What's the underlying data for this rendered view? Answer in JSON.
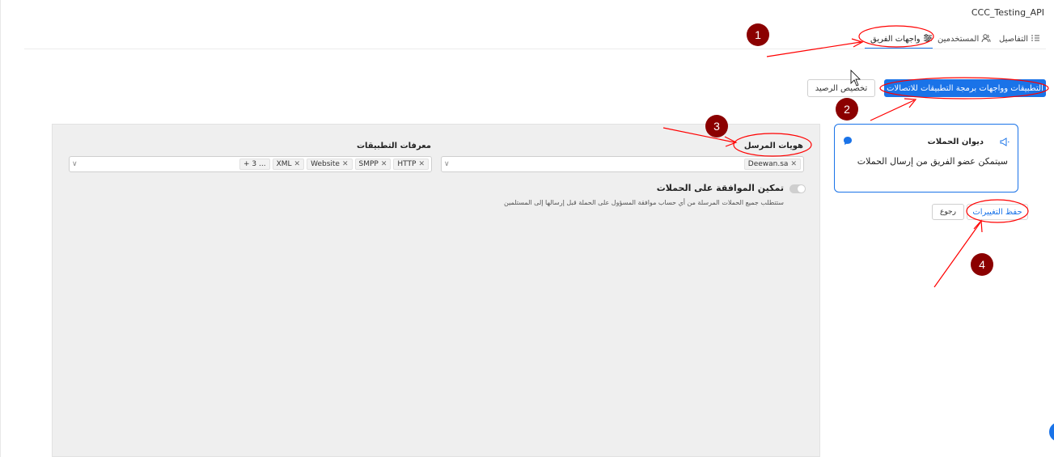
{
  "app": {
    "title": "CCC_Testing_API"
  },
  "tabs": [
    {
      "label": "التفاصيل"
    },
    {
      "label": "المستخدمين"
    },
    {
      "label": "واجهات الفريق"
    }
  ],
  "actions": {
    "primary_label": "التطبيقات وواجهات برمجة التطبيقات للاتصالات",
    "secondary_label": "تخصيص الرصيد"
  },
  "sender_ids": {
    "label": "هويات المرسل",
    "tags": [
      "Deewan.sa"
    ]
  },
  "app_ids": {
    "label": "معرفات التطبيقات",
    "tags": [
      "HTTP",
      "SMPP",
      "Website",
      "XML"
    ],
    "more": "+ 3 ..."
  },
  "approval": {
    "title": "تمكين الموافقة على الحملات",
    "description": "ستتطلب جميع الحملات المرسلة من أي حساب موافقة المسؤول على الحملة قبل إرسالها إلى المستلمين",
    "enabled": false
  },
  "card": {
    "title": "ديوان الحملات",
    "description": "سيتمكن عضو الفريق من إرسال الحملات"
  },
  "footer": {
    "save_label": "حفظ التغييرات",
    "back_label": "رجوع"
  },
  "annotations": [
    "1",
    "2",
    "3",
    "4"
  ],
  "colors": {
    "accent": "#1a73e8",
    "marker": "#8b0000",
    "annotation_line": "#ff0000"
  }
}
